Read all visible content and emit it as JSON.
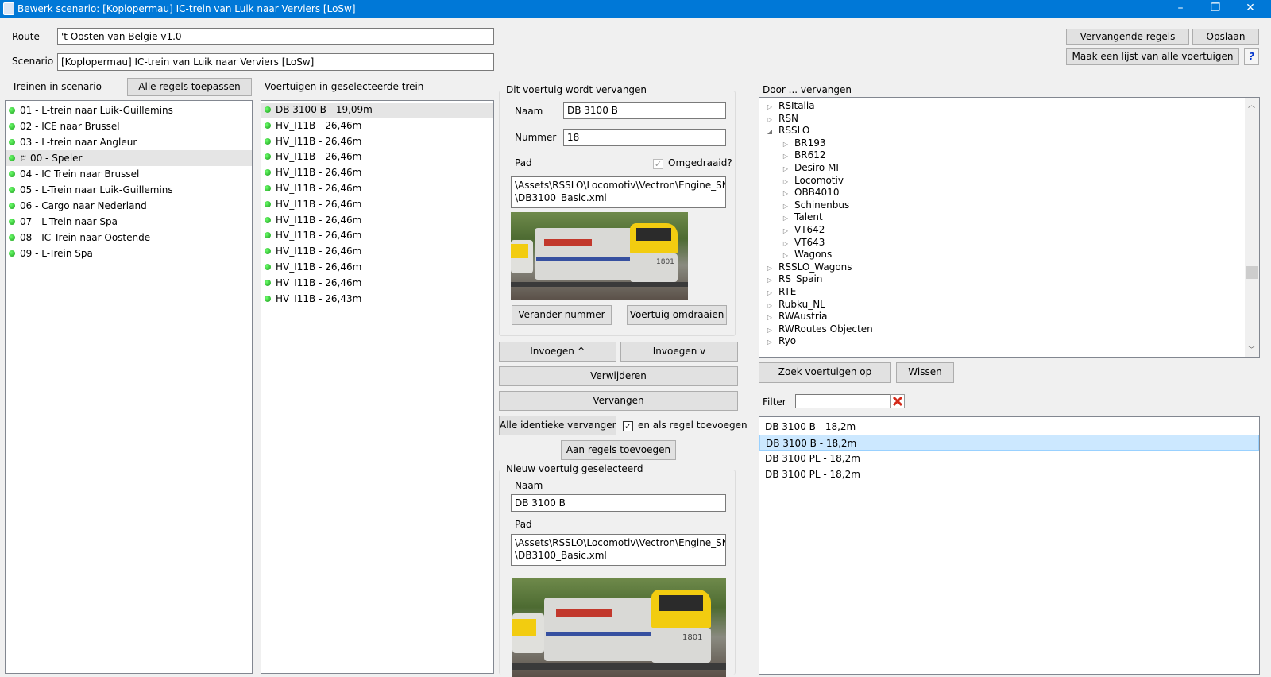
{
  "window": {
    "title": "Bewerk scenario: [Koplopermau] IC-trein van Luik naar Verviers [LoSw]",
    "minimize": "–",
    "restore": "❐",
    "close": "✕"
  },
  "route": {
    "label": "Route",
    "value": "'t Oosten van Belgie v1.0"
  },
  "scenario": {
    "label": "Scenario",
    "value": "[Koplopermau] IC-trein van Luik naar Verviers [LoSw]"
  },
  "trains_panel": {
    "label": "Treinen in scenario",
    "apply_all_button": "Alle regels toepassen",
    "items": [
      "01 - L-trein naar Luik-Guillemins",
      "02 - ICE naar Brussel",
      "03 - L-trein naar Angleur",
      "00 - Speler",
      "04 - IC Trein naar Brussel",
      "05 - L-Trein naar Luik-Guillemins",
      "06 - Cargo naar Nederland",
      "07 - L-Trein naar Spa",
      "08 - IC Trein naar Oostende",
      "09 - L-Trein Spa"
    ],
    "player_marker": "♖"
  },
  "vehicles_panel": {
    "label": "Voertuigen in geselecteerde trein",
    "items": [
      "DB 3100 B - 19,09m",
      "HV_I11B - 26,46m",
      "HV_I11B - 26,46m",
      "HV_I11B - 26,46m",
      "HV_I11B - 26,46m",
      "HV_I11B - 26,46m",
      "HV_I11B - 26,46m",
      "HV_I11B - 26,46m",
      "HV_I11B - 26,46m",
      "HV_I11B - 26,46m",
      "HV_I11B - 26,46m",
      "HV_I11B - 26,46m",
      "HV_I11B - 26,43m"
    ]
  },
  "replaced": {
    "group_title": "Dit voertuig wordt vervangen",
    "name_label": "Naam",
    "name_value": "DB 3100 B",
    "number_label": "Nummer",
    "number_value": "18",
    "path_label": "Pad",
    "reversed_label": "Omgedraaid?",
    "reversed_check": "✓",
    "path_value_1": "\\Assets\\RSSLO\\Locomotiv\\Vectron\\Engine_SNCB",
    "path_value_2": "\\DB3100_Basic.xml",
    "change_number_button": "Verander nummer",
    "reverse_button": "Voertuig omdraaien",
    "loco_number": "1801"
  },
  "actions": {
    "insert_up": "Invoegen ^",
    "insert_down": "Invoegen v",
    "delete": "Verwijderen",
    "replace": "Vervangen",
    "replace_all_identical": "Alle identieke vervangen",
    "add_as_rule_label": "en als regel toevoegen",
    "add_as_rule_check": "✓",
    "add_to_rules": "Aan regels toevoegen"
  },
  "new_vehicle": {
    "group_title": "Nieuw voertuig geselecteerd",
    "name_label": "Naam",
    "name_value": "DB 3100 B",
    "path_label": "Pad",
    "path_value_1": "\\Assets\\RSSLO\\Locomotiv\\Vectron\\Engine_SNCB",
    "path_value_2": "\\DB3100_Basic.xml",
    "loco_number": "1801"
  },
  "top_right": {
    "replacement_rules_button": "Vervangende regels",
    "save_button": "Opslaan",
    "list_all_button": "Maak een lijst van alle voertuigen",
    "help_button": "?"
  },
  "replace_by": {
    "label": "Door ... vervangen",
    "tree": [
      {
        "label": "RSItalia",
        "level": 0,
        "expanded": false
      },
      {
        "label": "RSN",
        "level": 0,
        "expanded": false
      },
      {
        "label": "RSSLO",
        "level": 0,
        "expanded": true
      },
      {
        "label": "BR193",
        "level": 1,
        "expanded": false
      },
      {
        "label": "BR612",
        "level": 1,
        "expanded": false
      },
      {
        "label": "Desiro MI",
        "level": 1,
        "expanded": false
      },
      {
        "label": "Locomotiv",
        "level": 1,
        "expanded": false
      },
      {
        "label": "OBB4010",
        "level": 1,
        "expanded": false
      },
      {
        "label": "Schinenbus",
        "level": 1,
        "expanded": false
      },
      {
        "label": "Talent",
        "level": 1,
        "expanded": false
      },
      {
        "label": "VT642",
        "level": 1,
        "expanded": false
      },
      {
        "label": "VT643",
        "level": 1,
        "expanded": false
      },
      {
        "label": "Wagons",
        "level": 1,
        "expanded": false
      },
      {
        "label": "RSSLO_Wagons",
        "level": 0,
        "expanded": false
      },
      {
        "label": "RS_Spain",
        "level": 0,
        "expanded": false
      },
      {
        "label": "RTE",
        "level": 0,
        "expanded": false
      },
      {
        "label": "Rubku_NL",
        "level": 0,
        "expanded": false
      },
      {
        "label": "RWAustria",
        "level": 0,
        "expanded": false
      },
      {
        "label": "RWRoutes Objecten",
        "level": 0,
        "expanded": false
      },
      {
        "label": "Ryo",
        "level": 0,
        "expanded": false
      }
    ],
    "search_button": "Zoek voertuigen op",
    "clear_button": "Wissen",
    "filter_label": "Filter",
    "filter_value": "",
    "results": [
      "DB 3100 B - 18,2m",
      "DB 3100 B - 18,2m",
      "DB 3100 PL - 18,2m",
      "DB 3100 PL - 18,2m"
    ]
  }
}
